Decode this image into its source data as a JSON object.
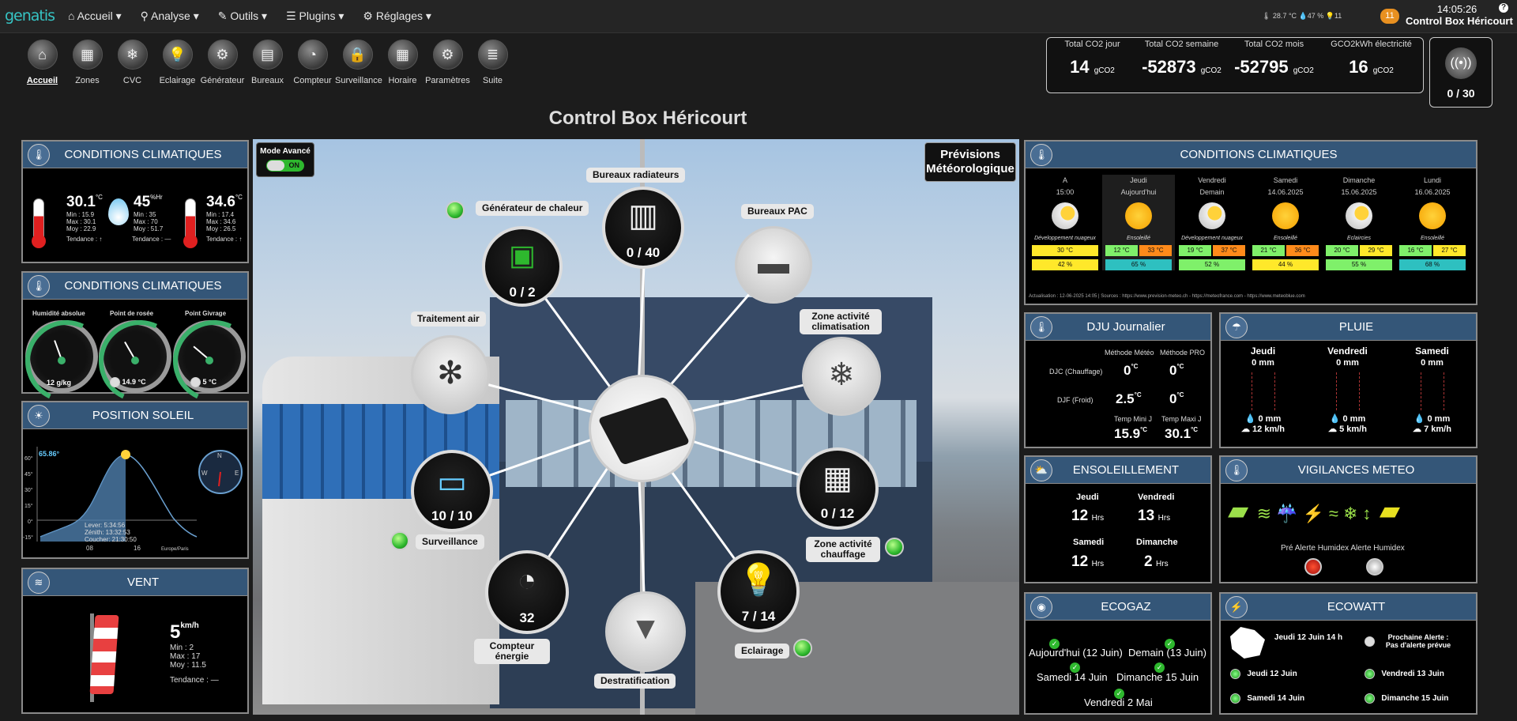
{
  "topbar": {
    "logo": "genatis",
    "menu": [
      "Accueil",
      "Analyse",
      "Outils",
      "Plugins",
      "Réglages"
    ],
    "weather": "🌡 28.7 °C  💧47 %  💡11",
    "notifications": "11",
    "time": "14:05:26",
    "site": "Control Box Héricourt",
    "help": "?"
  },
  "toolbar": [
    {
      "label": "Accueil",
      "icon": "home-icon",
      "glyph": "⌂"
    },
    {
      "label": "Zones",
      "icon": "zones-icon",
      "glyph": "▦"
    },
    {
      "label": "CVC",
      "icon": "cvc-icon",
      "glyph": "❄"
    },
    {
      "label": "Eclairage",
      "icon": "bulb-icon",
      "glyph": "💡"
    },
    {
      "label": "Générateur",
      "icon": "generator-icon",
      "glyph": "⚙"
    },
    {
      "label": "Bureaux",
      "icon": "office-icon",
      "glyph": "▤"
    },
    {
      "label": "Compteur",
      "icon": "meter-icon",
      "glyph": "◔"
    },
    {
      "label": "Surveillance",
      "icon": "camera-icon",
      "glyph": "🔒"
    },
    {
      "label": "Horaire",
      "icon": "calendar-icon",
      "glyph": "▦"
    },
    {
      "label": "Paramètres",
      "icon": "gears-icon",
      "glyph": "⚙"
    },
    {
      "label": "Suite",
      "icon": "stack-icon",
      "glyph": "≣"
    }
  ],
  "co2": [
    {
      "title": "Total CO2 jour",
      "value": "14",
      "unit": "gCO2"
    },
    {
      "title": "Total CO2 semaine",
      "value": "-52873",
      "unit": "gCO2"
    },
    {
      "title": "Total CO2 mois",
      "value": "-52795",
      "unit": "gCO2"
    },
    {
      "title": "GCO2kWh électricité",
      "value": "16",
      "unit": "gCO2"
    }
  ],
  "bridge": {
    "value": "0 / 30"
  },
  "page_title": "Control Box Héricourt",
  "climat1": {
    "title": "CONDITIONS CLIMATIQUES",
    "temp1": {
      "value": "30.1",
      "unit": "°C",
      "min": "Min : 15.9",
      "max": "Max : 30.1",
      "moy": "Moy : 22.9"
    },
    "hum": {
      "value": "45",
      "unit": "%Hr",
      "min": "Min : 35",
      "max": "Max : 70",
      "moy": "Moy : 51.7"
    },
    "temp2": {
      "value": "34.6",
      "unit": "°C",
      "min": "Min : 17.4",
      "max": "Max : 34.6",
      "moy": "Moy : 26.5"
    },
    "trend1": "Tendance : ↑",
    "trend2": "Tendance : —",
    "trend3": "Tendance : ↑"
  },
  "climat2": {
    "title": "CONDITIONS CLIMATIQUES",
    "g1": {
      "label": "Humidité absolue",
      "value": "12 g/kg"
    },
    "g2": {
      "label": "Point de rosée",
      "value": "14.9 °C"
    },
    "g3": {
      "label": "Point Givrage",
      "value": "5 °C"
    }
  },
  "soleil": {
    "title": "POSITION SOLEIL",
    "elev": "65.86°",
    "lever": "Lever: 5:34:56",
    "zenith": "Zénith: 13:32:53",
    "coucher": "Coucher: 21:30:50",
    "x1": "08",
    "x2": "16",
    "tz": "Europe/Paris",
    "y": [
      "60°",
      "45°",
      "30°",
      "15°",
      "0°",
      "-15°"
    ]
  },
  "vent": {
    "title": "VENT",
    "value": "5",
    "unit": "km/h",
    "min": "Min : 2",
    "max": "Max : 17",
    "moy": "Moy : 11.5",
    "trend": "Tendance : —"
  },
  "scene": {
    "mode": "Mode Avancé",
    "toggle": "ON",
    "prev": "Prévisions Météorologique",
    "nodes": {
      "gen": {
        "label": "Générateur de chaleur",
        "count": "0 / 2"
      },
      "bur_rad": {
        "label": "Bureaux radiateurs",
        "count": "0 / 40"
      },
      "bur_pac": {
        "label": "Bureaux PAC"
      },
      "trait": {
        "label": "Traitement air"
      },
      "clim": {
        "label": "Zone activité climatisation"
      },
      "surv": {
        "label": "Surveillance",
        "count": "10 / 10"
      },
      "chauf": {
        "label": "Zone activité chauffage",
        "count": "0 / 12"
      },
      "compt": {
        "label": "Compteur énergie",
        "count": "32"
      },
      "destr": {
        "label": "Destratification"
      },
      "ecl": {
        "label": "Eclairage",
        "count": "7 / 14"
      }
    }
  },
  "forecast": {
    "title": "CONDITIONS CLIMATIQUES",
    "cols": [
      {
        "d": "A",
        "d2": "15:00",
        "desc": "Développement nuageux",
        "tmin": "30",
        "tmax": "",
        "hum": "42",
        "icon": "cloud-sun-icon"
      },
      {
        "d": "Jeudi",
        "d2": "Aujourd'hui",
        "desc": "Ensoleillé",
        "tmin": "12",
        "tmax": "33",
        "hum": "65",
        "icon": "sun-icon"
      },
      {
        "d": "Vendredi",
        "d2": "Demain",
        "desc": "Développement nuageux",
        "tmin": "19",
        "tmax": "37",
        "hum": "52",
        "icon": "cloud-sun-icon"
      },
      {
        "d": "Samedi",
        "d2": "14.06.2025",
        "desc": "Ensoleillé",
        "tmin": "21",
        "tmax": "36",
        "hum": "44",
        "icon": "sun-icon"
      },
      {
        "d": "Dimanche",
        "d2": "15.06.2025",
        "desc": "Eclaircies",
        "tmin": "20",
        "tmax": "29",
        "hum": "55",
        "icon": "cloud-sun-icon"
      },
      {
        "d": "Lundi",
        "d2": "16.06.2025",
        "desc": "Ensoleillé",
        "tmin": "16",
        "tmax": "27",
        "hum": "68",
        "icon": "sun-icon"
      }
    ],
    "footer": "Actualisation : 12-06-2025 14:05 | Sources : https://www.prevision-meteo.ch - https://meteofrance.com - https://www.meteoblue.com",
    "unit": "°C",
    "hunit": "%"
  },
  "dju": {
    "title": "DJU Journalier",
    "h1": "Méthode Météo",
    "h2": "Méthode PRO",
    "r1": "DJC (Chauffage)",
    "r2": "DJF (Froid)",
    "v11": "0",
    "v12": "0",
    "v21": "2.5",
    "v22": "0",
    "tl1": "Temp Mini J",
    "tl2": "Temp Maxi J",
    "t1": "15.9",
    "t2": "30.1",
    "u": "°C"
  },
  "pluie": {
    "title": "PLUIE",
    "days": [
      {
        "d": "Jeudi",
        "mm": "0 mm",
        "r": "0 mm",
        "w": "12 km/h"
      },
      {
        "d": "Vendredi",
        "mm": "0 mm",
        "r": "0 mm",
        "w": "5 km/h"
      },
      {
        "d": "Samedi",
        "mm": "0 mm",
        "r": "0 mm",
        "w": "7 km/h"
      }
    ]
  },
  "ensol": {
    "title": "ENSOLEILLEMENT",
    "d": [
      {
        "d": "Jeudi",
        "v": "12"
      },
      {
        "d": "Vendredi",
        "v": "13"
      },
      {
        "d": "Samedi",
        "v": "12"
      },
      {
        "d": "Dimanche",
        "v": "2"
      }
    ],
    "u": "Hrs"
  },
  "vigil": {
    "title": "VIGILANCES METEO",
    "l1": "Pré Alerte Humidex",
    "l2": "Alerte Humidex"
  },
  "ecogaz": {
    "title": "ECOGAZ",
    "items": [
      "Aujourd'hui (12 Juin)",
      "Demain (13 Juin)",
      "Samedi 14 Juin",
      "Dimanche 15 Juin",
      "Vendredi 2 Mai"
    ]
  },
  "ecowatt": {
    "title": "ECOWATT",
    "now": "Jeudi 12 Juin 14 h",
    "next": "Prochaine Alerte :",
    "none": "Pas d'alerte prévue",
    "items": [
      "Jeudi 12 Juin",
      "Vendredi 13 Juin",
      "Samedi 14 Juin",
      "Dimanche 15 Juin"
    ]
  }
}
